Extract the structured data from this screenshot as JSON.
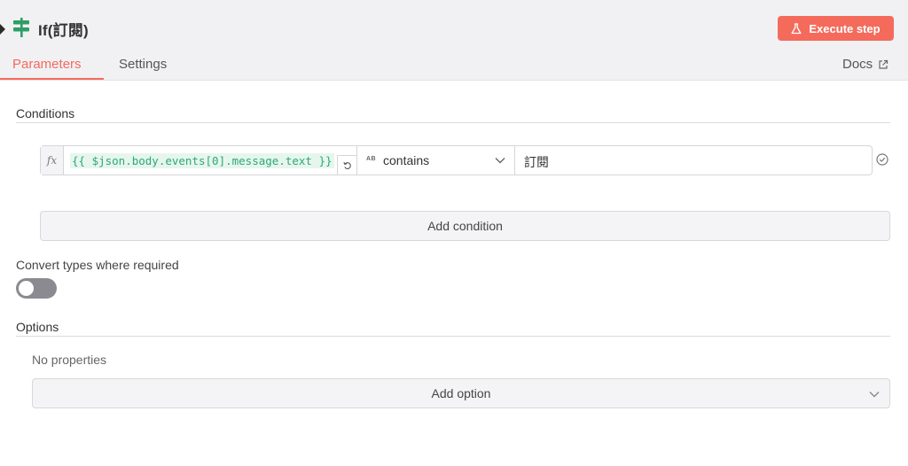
{
  "header": {
    "title": "If(訂閱)",
    "execute_label": "Execute step",
    "tabs": [
      {
        "label": "Parameters",
        "active": true
      },
      {
        "label": "Settings",
        "active": false
      }
    ],
    "docs_label": "Docs",
    "accent_color": "#f46b5c"
  },
  "conditions": {
    "title": "Conditions",
    "rows": [
      {
        "fx_label": "fx",
        "left_value": "{{ $json.body.events[0].message.text }}",
        "operator_type": "AB",
        "operator": "contains",
        "right_value": "訂閱"
      }
    ],
    "add_label": "Add condition"
  },
  "convert_types": {
    "label": "Convert types where required",
    "enabled": false
  },
  "options": {
    "title": "Options",
    "empty_text": "No properties",
    "add_label": "Add option"
  }
}
